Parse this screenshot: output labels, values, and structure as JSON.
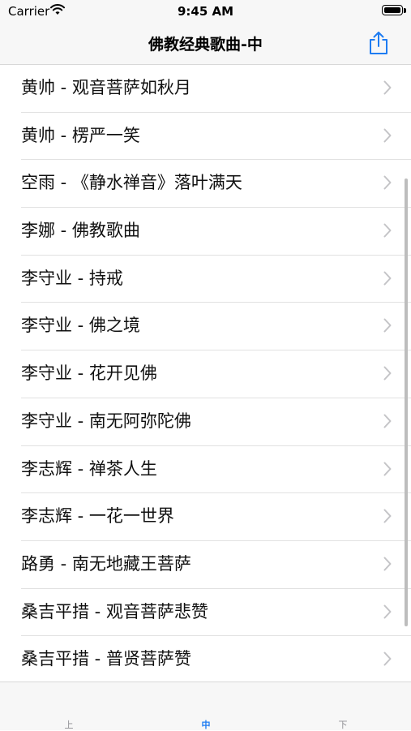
{
  "status": {
    "carrier": "Carrier",
    "time": "9:45 AM"
  },
  "nav": {
    "title": "佛教经典歌曲-中",
    "share_icon": "share-icon"
  },
  "songs": [
    "黄帅 - 观音菩萨如秋月",
    "黄帅 - 楞严一笑",
    "空雨 - 《静水禅音》落叶满天",
    "李娜 - 佛教歌曲",
    "李守业 - 持戒",
    "李守业 - 佛之境",
    "李守业 - 花开见佛",
    "李守业 - 南无阿弥陀佛",
    "李志辉 - 禅茶人生",
    "李志辉 - 一花一世界",
    "路勇 - 南无地藏王菩萨",
    "桑吉平措 - 观音菩萨悲赞",
    "桑吉平措 - 普贤菩萨赞"
  ],
  "tabs": [
    {
      "label": "上",
      "active": false
    },
    {
      "label": "中",
      "active": true
    },
    {
      "label": "下",
      "active": false
    }
  ],
  "colors": {
    "accent": "#1e7cf2",
    "chevron": "#c4c4c7",
    "separator": "#e1e1e1"
  }
}
